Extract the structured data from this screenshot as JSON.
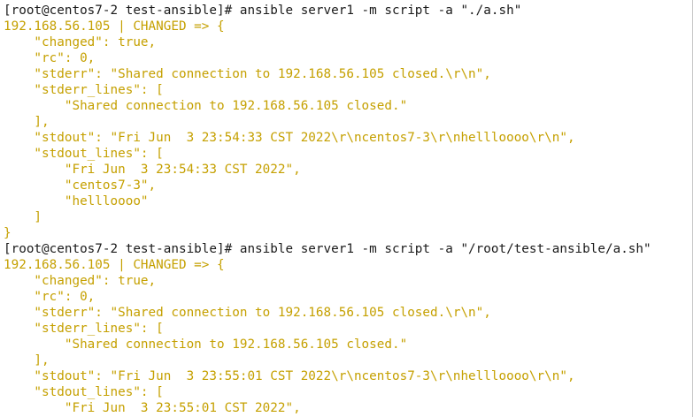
{
  "colors": {
    "background": "#ffffff",
    "prompt_text": "#1a1a1a",
    "output_text": "#c5a000"
  },
  "terminal": {
    "lines": [
      {
        "type": "cmd",
        "text": "[root@centos7-2 test-ansible]# ansible server1 -m script -a \"./a.sh\""
      },
      {
        "type": "out",
        "text": "192.168.56.105 | CHANGED => {"
      },
      {
        "type": "out",
        "text": "    \"changed\": true,"
      },
      {
        "type": "out",
        "text": "    \"rc\": 0,"
      },
      {
        "type": "out",
        "text": "    \"stderr\": \"Shared connection to 192.168.56.105 closed.\\r\\n\","
      },
      {
        "type": "out",
        "text": "    \"stderr_lines\": ["
      },
      {
        "type": "out",
        "text": "        \"Shared connection to 192.168.56.105 closed.\""
      },
      {
        "type": "out",
        "text": "    ],"
      },
      {
        "type": "out",
        "text": "    \"stdout\": \"Fri Jun  3 23:54:33 CST 2022\\r\\ncentos7-3\\r\\nhellloooo\\r\\n\","
      },
      {
        "type": "out",
        "text": "    \"stdout_lines\": ["
      },
      {
        "type": "out",
        "text": "        \"Fri Jun  3 23:54:33 CST 2022\","
      },
      {
        "type": "out",
        "text": "        \"centos7-3\","
      },
      {
        "type": "out",
        "text": "        \"hellloooo\""
      },
      {
        "type": "out",
        "text": "    ]"
      },
      {
        "type": "out",
        "text": "}"
      },
      {
        "type": "cmd",
        "text": "[root@centos7-2 test-ansible]# ansible server1 -m script -a \"/root/test-ansible/a.sh\""
      },
      {
        "type": "out",
        "text": "192.168.56.105 | CHANGED => {"
      },
      {
        "type": "out",
        "text": "    \"changed\": true,"
      },
      {
        "type": "out",
        "text": "    \"rc\": 0,"
      },
      {
        "type": "out",
        "text": "    \"stderr\": \"Shared connection to 192.168.56.105 closed.\\r\\n\","
      },
      {
        "type": "out",
        "text": "    \"stderr_lines\": ["
      },
      {
        "type": "out",
        "text": "        \"Shared connection to 192.168.56.105 closed.\""
      },
      {
        "type": "out",
        "text": "    ],"
      },
      {
        "type": "out",
        "text": "    \"stdout\": \"Fri Jun  3 23:55:01 CST 2022\\r\\ncentos7-3\\r\\nhellloooo\\r\\n\","
      },
      {
        "type": "out",
        "text": "    \"stdout_lines\": ["
      },
      {
        "type": "out",
        "text": "        \"Fri Jun  3 23:55:01 CST 2022\","
      }
    ]
  }
}
